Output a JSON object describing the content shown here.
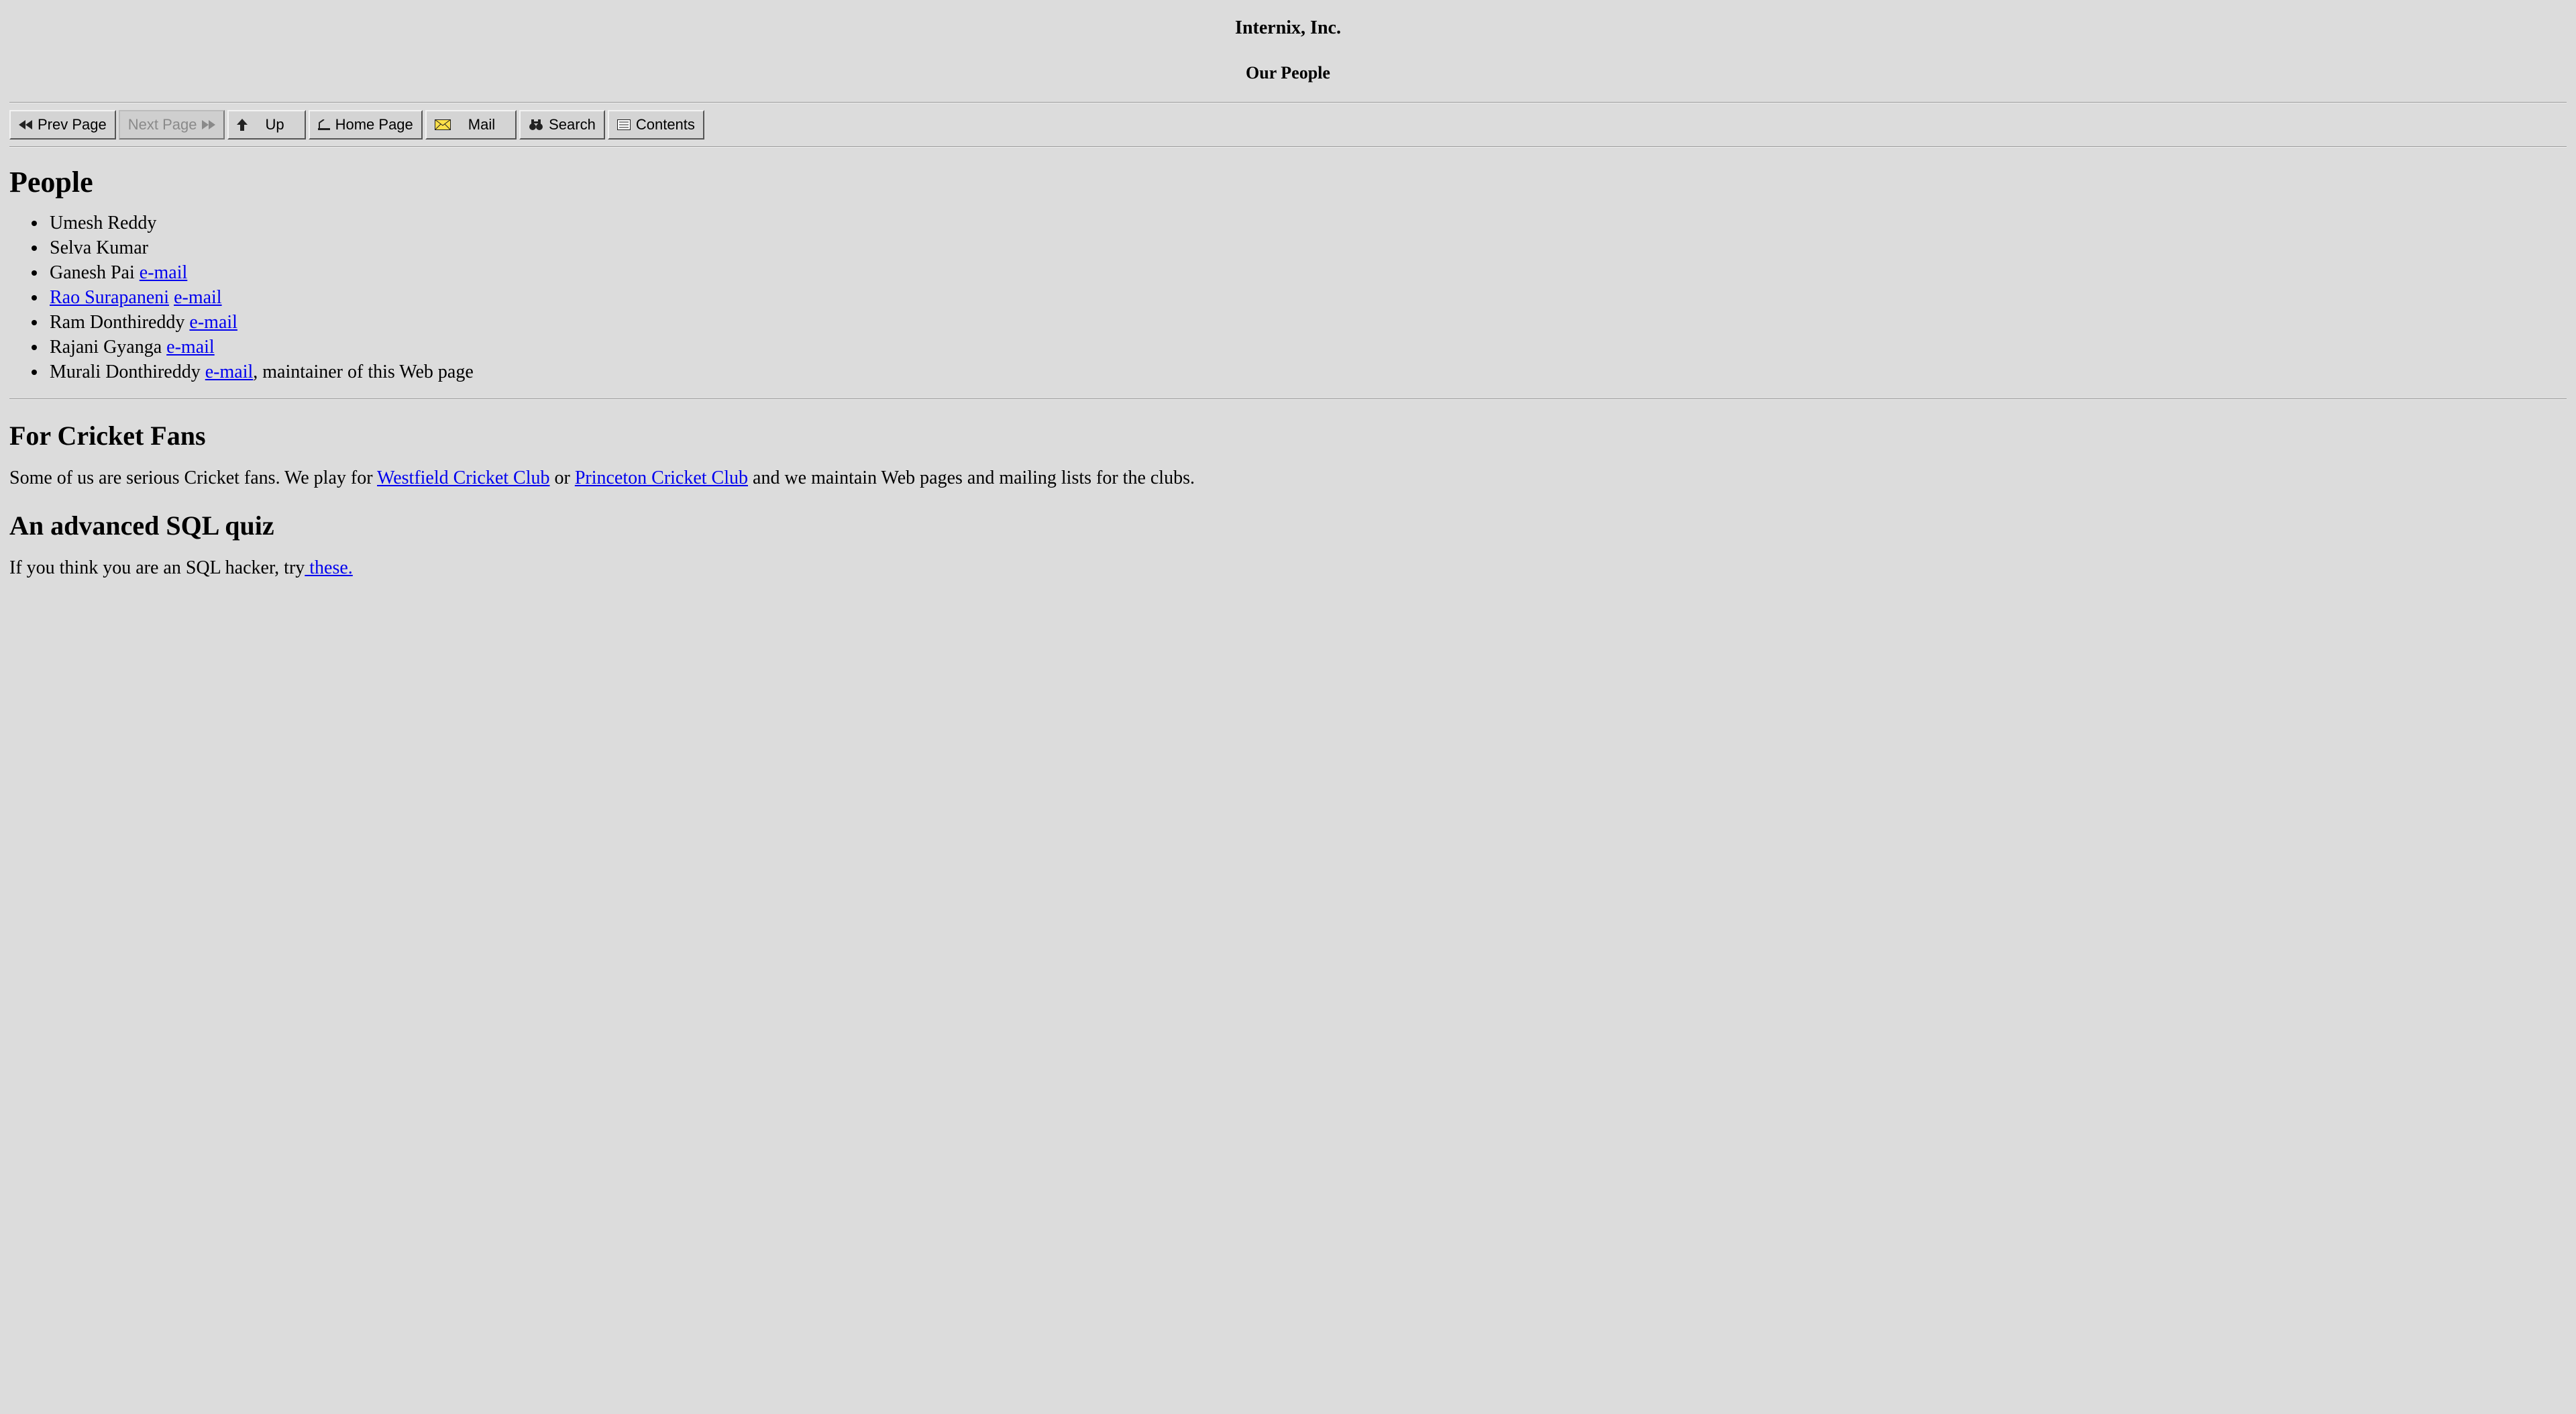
{
  "header": {
    "company": "Internix, Inc.",
    "subtitle": "Our People"
  },
  "toolbar": {
    "buttons": [
      {
        "id": "prev",
        "label": "Prev Page",
        "icon": "rewind-icon",
        "enabled": true
      },
      {
        "id": "next",
        "label": "Next Page",
        "icon": "forward-icon",
        "enabled": false
      },
      {
        "id": "up",
        "label": "Up",
        "icon": "up-arrow-icon",
        "enabled": true
      },
      {
        "id": "home",
        "label": "Home Page",
        "icon": "home-icon",
        "enabled": true
      },
      {
        "id": "mail",
        "label": "Mail",
        "icon": "envelope-icon",
        "enabled": true
      },
      {
        "id": "search",
        "label": "Search",
        "icon": "binoculars-icon",
        "enabled": true
      },
      {
        "id": "contents",
        "label": "Contents",
        "icon": "contents-icon",
        "enabled": true
      }
    ]
  },
  "sections": {
    "people": {
      "heading": "People",
      "items": [
        {
          "name": "Umesh Reddy",
          "name_is_link": false,
          "email_link": null,
          "trailing": null
        },
        {
          "name": "Selva Kumar",
          "name_is_link": false,
          "email_link": null,
          "trailing": null
        },
        {
          "name": "Ganesh Pai",
          "name_is_link": false,
          "email_link": "e-mail",
          "trailing": null
        },
        {
          "name": "Rao Surapaneni",
          "name_is_link": true,
          "email_link": "e-mail",
          "trailing": null
        },
        {
          "name": "Ram Donthireddy",
          "name_is_link": false,
          "email_link": "e-mail",
          "trailing": null
        },
        {
          "name": "Rajani Gyanga",
          "name_is_link": false,
          "email_link": "e-mail",
          "trailing": null
        },
        {
          "name": "Murali Donthireddy",
          "name_is_link": false,
          "email_link": "e-mail",
          "trailing": ", maintainer of this Web page"
        }
      ]
    },
    "cricket": {
      "heading": "For Cricket Fans",
      "paragraph": {
        "pre": "Some of us are serious Cricket fans. We play for ",
        "link1": "Westfield Cricket Club",
        "mid": " or ",
        "link2": "Princeton Cricket Club",
        "post": " and we maintain Web pages and mailing lists for the clubs."
      }
    },
    "sql": {
      "heading": "An advanced SQL quiz",
      "paragraph": {
        "pre": "If you think you are an SQL hacker, try",
        "link": " these."
      }
    }
  }
}
